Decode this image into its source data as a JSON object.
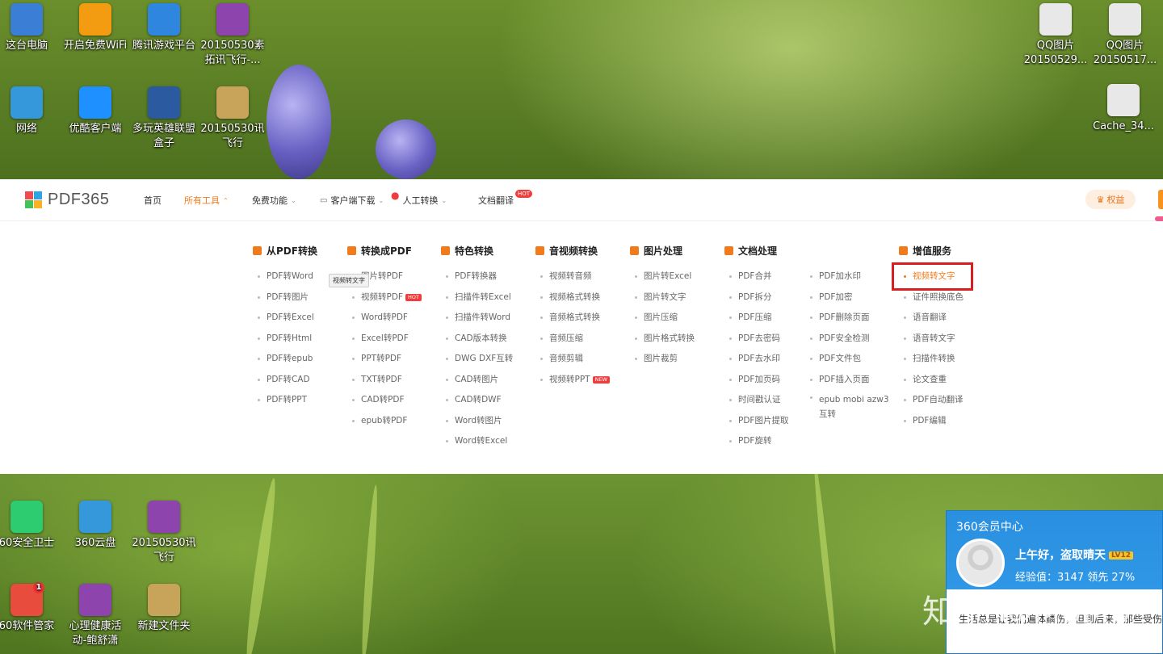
{
  "desktop": {
    "icons_top": [
      {
        "label": "这台电脑",
        "icon": "computer-icon",
        "color": "#3a7fd5"
      },
      {
        "label": "开启免费WiFi",
        "icon": "wifi-icon",
        "color": "#f39c12"
      },
      {
        "label": "腾讯游戏平台",
        "icon": "game-platform-icon",
        "color": "#2e86de"
      },
      {
        "label": "20150530素拓讯飞行-...",
        "icon": "archive-icon",
        "color": "#8e44ad"
      },
      {
        "label": "网络",
        "icon": "network-icon",
        "color": "#3498db"
      },
      {
        "label": "优酷客户端",
        "icon": "youku-icon",
        "color": "#1e90ff"
      },
      {
        "label": "多玩英雄联盟盒子",
        "icon": "game-box-icon",
        "color": "#2c5aa0"
      },
      {
        "label": "20150530讯飞行",
        "icon": "folder-icon",
        "color": "#c8a45a"
      }
    ],
    "icons_right": [
      {
        "label": "QQ图片20150529...",
        "icon": "image-thumbnail-icon"
      },
      {
        "label": "QQ图片20150517...",
        "icon": "image-thumbnail-icon"
      },
      {
        "label": "Cache_34...",
        "icon": "phone-image-icon"
      }
    ],
    "icons_bottom": [
      {
        "label": "60安全卫士",
        "icon": "security-guard-icon",
        "color": "#2ecc71"
      },
      {
        "label": "360云盘",
        "icon": "cloud-disk-icon",
        "color": "#3498db"
      },
      {
        "label": "20150530讯飞行",
        "icon": "archive-icon",
        "color": "#8e44ad"
      },
      {
        "label": "60软件管家",
        "icon": "software-manager-icon",
        "color": "#e74c3c",
        "badge": "1"
      },
      {
        "label": "心理健康活动-鲍舒潇",
        "icon": "archive-icon",
        "color": "#8e44ad"
      },
      {
        "label": "新建文件夹",
        "icon": "folder-icon",
        "color": "#c8a45a"
      }
    ]
  },
  "pdf365": {
    "logo_text": "PDF365",
    "nav": {
      "home": "首页",
      "all_tools": "所有工具",
      "free": "免费功能",
      "client": "客户端下载",
      "manual": "人工转换",
      "doc_translate": "文档翻译",
      "hot": "HOT",
      "equity": "权益"
    },
    "tooltip": "视频转文字",
    "columns": [
      {
        "title": "从PDF转换",
        "items": [
          "PDF转Word",
          "PDF转图片",
          "PDF转Excel",
          "PDF转Html",
          "PDF转epub",
          "PDF转CAD",
          "PDF转PPT"
        ]
      },
      {
        "title": "转换成PDF",
        "items": [
          "图片转PDF",
          "视频转PDF",
          "Word转PDF",
          "Excel转PDF",
          "PPT转PDF",
          "TXT转PDF",
          "CAD转PDF",
          "epub转PDF"
        ],
        "tag": "HOT"
      },
      {
        "title": "特色转换",
        "items": [
          "PDF转换器",
          "扫描件转Excel",
          "扫描件转Word",
          "CAD版本转换",
          "DWG DXF互转",
          "CAD转图片",
          "CAD转DWF",
          "Word转图片",
          "Word转Excel"
        ]
      },
      {
        "title": "音视频转换",
        "items": [
          "视频转音频",
          "视频格式转换",
          "音频格式转换",
          "音频压缩",
          "音频剪辑",
          "视频转PPT"
        ],
        "tag": "NEW"
      },
      {
        "title": "图片处理",
        "items": [
          "图片转Excel",
          "图片转文字",
          "图片压缩",
          "图片格式转换",
          "图片裁剪"
        ]
      },
      {
        "title": "文档处理",
        "items": [
          "PDF合并",
          "PDF拆分",
          "PDF压缩",
          "PDF去密码",
          "PDF去水印",
          "PDF加页码",
          "时间戳认证",
          "PDF图片提取",
          "PDF旋转"
        ]
      },
      {
        "title": "",
        "items": [
          "PDF加水印",
          "PDF加密",
          "PDF删除页面",
          "PDF安全检测",
          "PDF文件包",
          "PDF插入页面",
          "epub mobi azw3互转"
        ]
      },
      {
        "title": "增值服务",
        "items": [
          "视频转文字",
          "证件照换底色",
          "语音翻译",
          "语音转文字",
          "扫描件转换",
          "论文查重",
          "PDF自动翻译",
          "PDF编辑"
        ]
      }
    ]
  },
  "member": {
    "title": "360会员中心",
    "greeting": "上午好，盗取晴天",
    "level": "LV12",
    "exp": "经验值：3147   领先 27%",
    "note": "生活总是让我们遍体鳞伤，但到后来，那些受伤的地方一定会变成我们最强壮的地方。"
  },
  "watermark": "知乎 @MoMo"
}
